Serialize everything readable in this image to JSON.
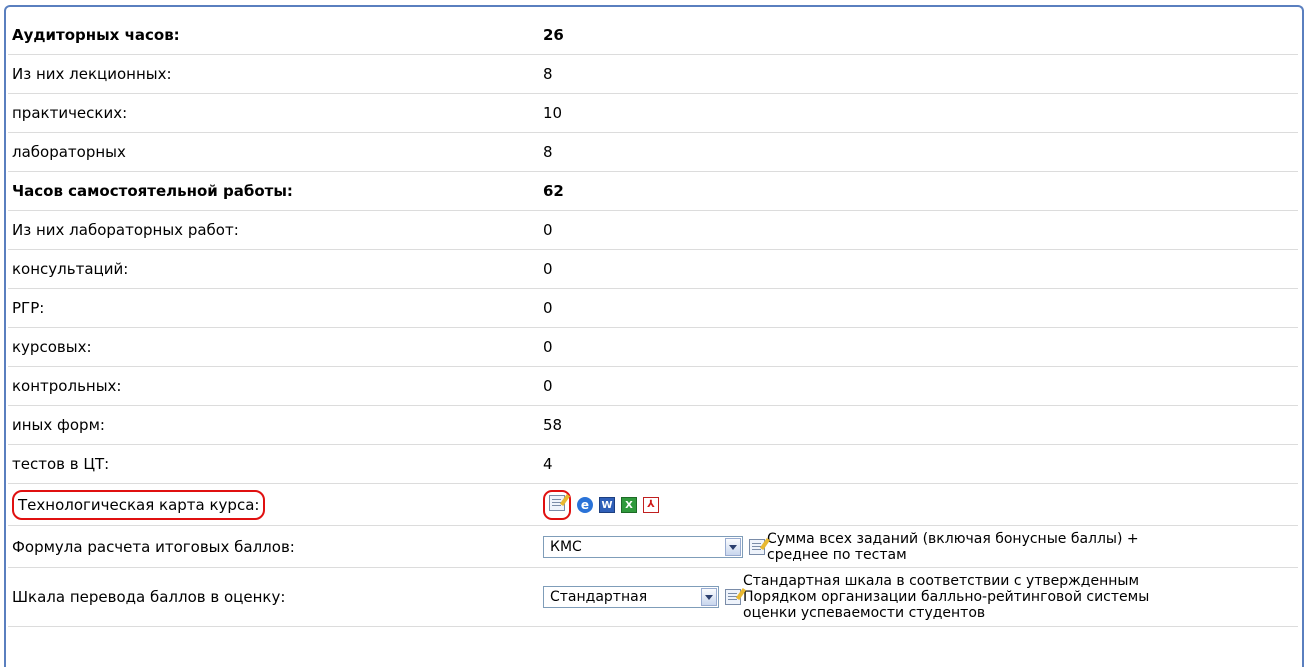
{
  "rows": [
    {
      "label": "Аудиторных часов:",
      "value": "26"
    },
    {
      "label": "Из них лекционных:",
      "value": "8"
    },
    {
      "label": "практических:",
      "value": "10"
    },
    {
      "label": "лабораторных",
      "value": "8"
    },
    {
      "label": "Часов самостоятельной работы:",
      "value": "62"
    },
    {
      "label": "Из них лабораторных работ:",
      "value": "0"
    },
    {
      "label": "консультаций:",
      "value": "0"
    },
    {
      "label": "РГР:",
      "value": "0"
    },
    {
      "label": "курсовых:",
      "value": "0"
    },
    {
      "label": "контрольных:",
      "value": "0"
    },
    {
      "label": "иных форм:",
      "value": "58"
    },
    {
      "label": "тестов в ЦТ:",
      "value": "4"
    }
  ],
  "tech_card": {
    "label": "Технологическая карта курса:"
  },
  "formula": {
    "label": "Формула расчета итоговых баллов:",
    "selected": "КМС",
    "description_line1": "Сумма всех заданий (включая бонусные баллы) +",
    "description_line2": "среднее по тестам"
  },
  "scale": {
    "label": "Шкала перевода баллов в оценку:",
    "selected": "Стандартная",
    "description_line1": "Стандартная шкала в соответствии с утвержденным",
    "description_line2": "Порядком организации балльно-рейтинговой системы",
    "description_line3": "оценки успеваемости студентов"
  },
  "icons": [
    "edit-icon",
    "ie-icon",
    "word-icon",
    "excel-icon",
    "pdf-icon"
  ],
  "colors": {
    "highlight": "#e01010",
    "frame": "#5a7fbf"
  }
}
